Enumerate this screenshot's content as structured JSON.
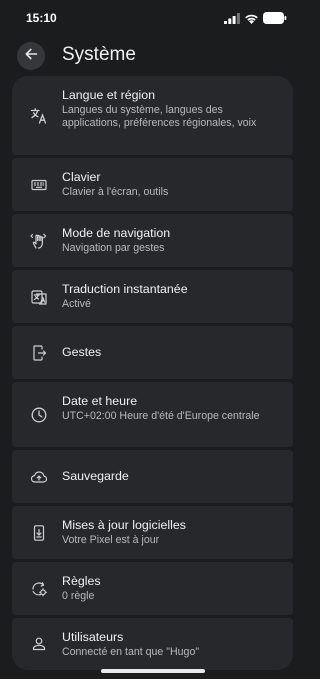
{
  "status": {
    "time": "15:10"
  },
  "header": {
    "title": "Système"
  },
  "items": [
    {
      "label": "Langue et région",
      "desc": "Langues du système, langues des applications, préférences régionales, voix",
      "icon": "translate-icon"
    },
    {
      "label": "Clavier",
      "desc": "Clavier à l'écran, outils",
      "icon": "keyboard-icon"
    },
    {
      "label": "Mode de navigation",
      "desc": "Navigation par gestes",
      "icon": "gesture-hand-icon"
    },
    {
      "label": "Traduction instantanée",
      "desc": "Activé",
      "icon": "live-translate-icon"
    },
    {
      "label": "Gestes",
      "desc": "",
      "icon": "phone-gesture-icon"
    },
    {
      "label": "Date et heure",
      "desc": "UTC+02:00 Heure d'été d'Europe centrale",
      "icon": "clock-icon"
    },
    {
      "label": "Sauvegarde",
      "desc": "",
      "icon": "cloud-upload-icon"
    },
    {
      "label": "Mises à jour logicielles",
      "desc": "Votre Pixel est à jour",
      "icon": "system-update-icon"
    },
    {
      "label": "Règles",
      "desc": "0 règle",
      "icon": "rules-icon"
    },
    {
      "label": "Utilisateurs",
      "desc": "Connecté en tant que \"Hugo\"",
      "icon": "person-icon"
    }
  ]
}
